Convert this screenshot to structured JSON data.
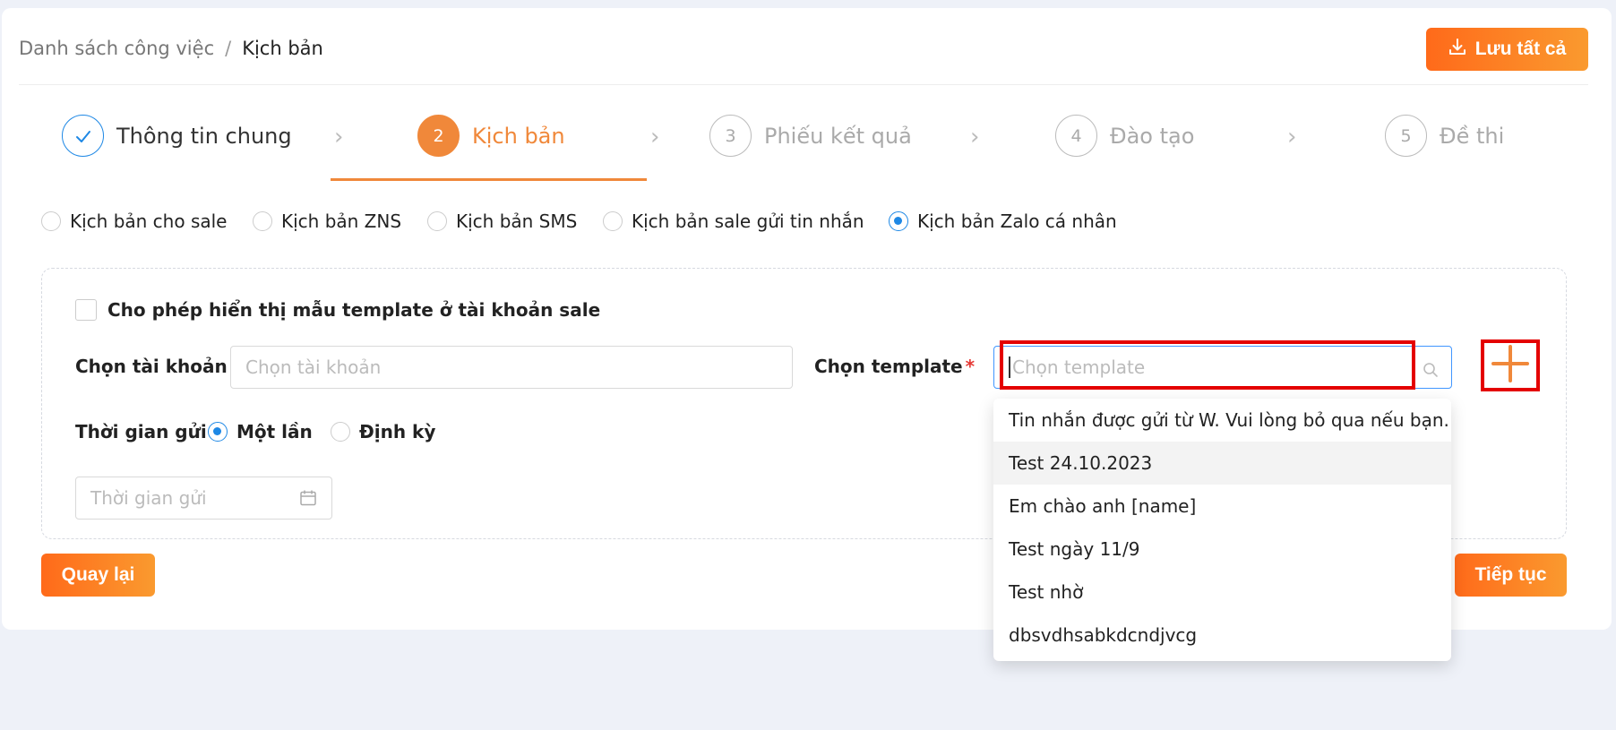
{
  "breadcrumb": {
    "parent": "Danh sách công việc",
    "separator": "/",
    "current": "Kịch bản"
  },
  "header": {
    "save_all_label": "Lưu tất cả"
  },
  "steps": [
    {
      "number": "",
      "label": "Thông tin chung",
      "state": "done"
    },
    {
      "number": "2",
      "label": "Kịch bản",
      "state": "active"
    },
    {
      "number": "3",
      "label": "Phiếu kết quả",
      "state": "pending"
    },
    {
      "number": "4",
      "label": "Đào tạo",
      "state": "pending"
    },
    {
      "number": "5",
      "label": "Đề thi",
      "state": "pending"
    }
  ],
  "script_types": [
    {
      "label": "Kịch bản cho sale",
      "selected": false
    },
    {
      "label": "Kịch bản ZNS",
      "selected": false
    },
    {
      "label": "Kịch bản SMS",
      "selected": false
    },
    {
      "label": "Kịch bản sale gửi tin nhắn",
      "selected": false
    },
    {
      "label": "Kịch bản Zalo cá nhân",
      "selected": true
    }
  ],
  "form": {
    "show_template_checkbox_label": "Cho phép hiển thị mẫu template ở tài khoản sale",
    "account_label": "Chọn tài khoản",
    "account_placeholder": "Chọn tài khoản",
    "template_label": "Chọn template",
    "template_placeholder": "Chọn template",
    "required_mark": "*",
    "send_time_label": "Thời gian gửi",
    "send_once_label": "Một lần",
    "send_periodic_label": "Định kỳ",
    "send_mode_selected": "Một lần",
    "send_time_placeholder": "Thời gian gửi"
  },
  "template_dropdown": {
    "options": [
      "Tin nhắn được gửi từ W. Vui lòng bỏ qua nếu bạn...",
      "Test 24.10.2023",
      "Em chào anh [name]",
      "Test ngày 11/9",
      "Test nhờ",
      "dbsvdhsabkdcndjvcg"
    ],
    "hovered_index": 1
  },
  "footer": {
    "back_label": "Quay lại",
    "next_label": "Tiếp tục"
  },
  "colors": {
    "accent_orange": "#f0883a",
    "primary_blue": "#1e88e5",
    "highlight_red": "#e40000"
  }
}
